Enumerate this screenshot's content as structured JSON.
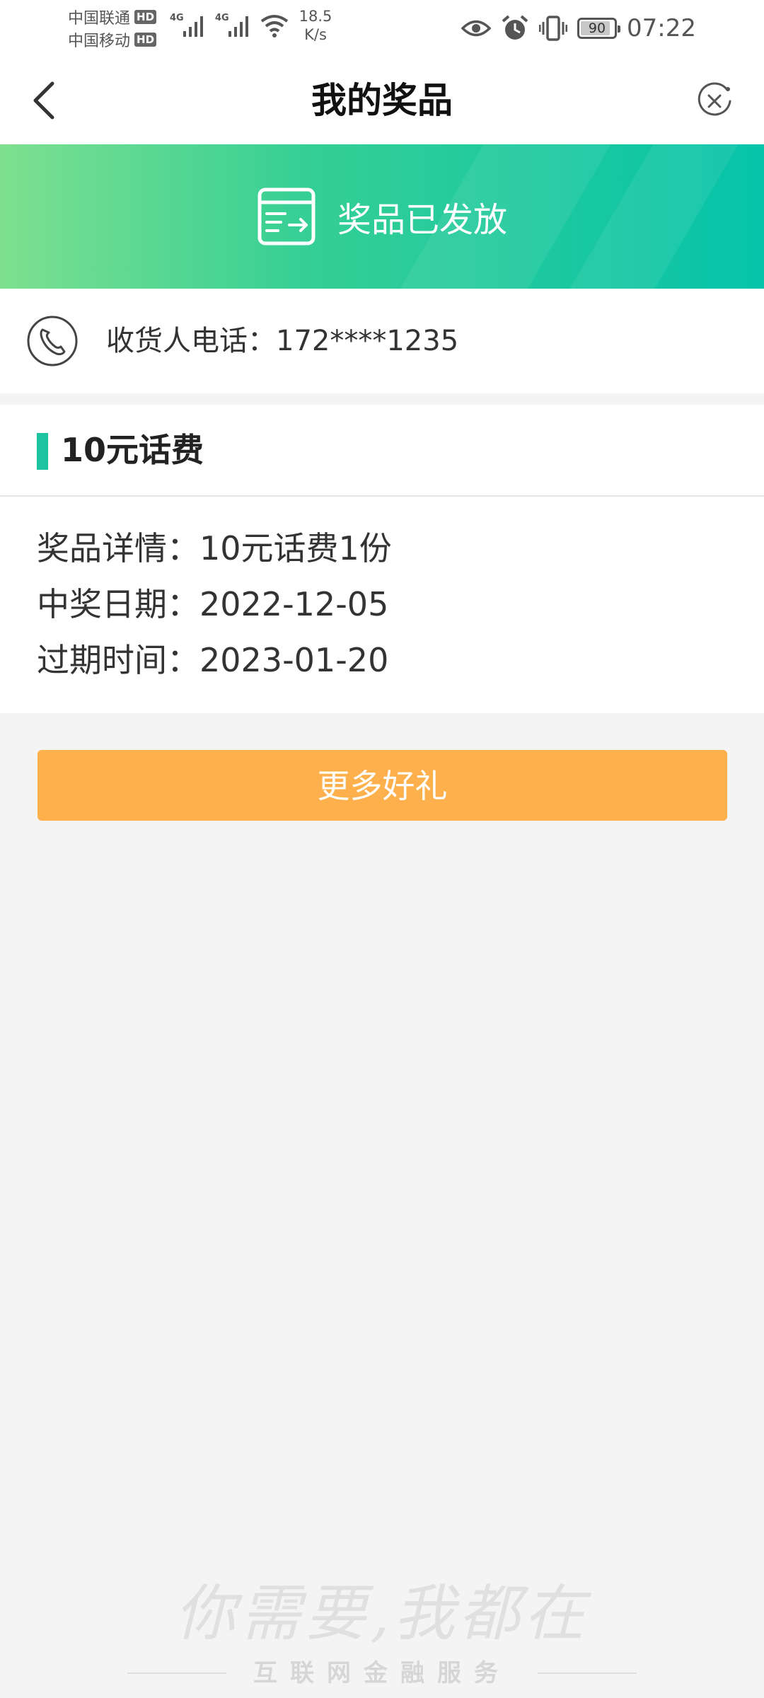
{
  "status_bar": {
    "carrier_1": "中国联通",
    "carrier_2": "中国移动",
    "hd_badge": "HD",
    "network_type": "4G",
    "net_speed_value": "18.5",
    "net_speed_unit": "K/s",
    "battery_level": "90",
    "time": "07:22",
    "icons": [
      "eye-icon",
      "alarm-icon",
      "vibrate-icon",
      "battery-icon",
      "wifi-icon",
      "signal-icon"
    ]
  },
  "navbar": {
    "title": "我的奖品"
  },
  "banner": {
    "text": "奖品已发放"
  },
  "phone_row": {
    "label": "收货人电话：172****1235"
  },
  "prize": {
    "title": "10元话费",
    "details": [
      {
        "label": "奖品详情：",
        "value": "10元话费1份"
      },
      {
        "label": "中奖日期：",
        "value": "2022-12-05"
      },
      {
        "label": "过期时间：",
        "value": "2023-01-20"
      }
    ]
  },
  "actions": {
    "more_gifts_label": "更多好礼"
  },
  "footer": {
    "slogan": "你需要,我都在",
    "tagline": "互联网金融服务"
  },
  "colors": {
    "banner_start": "#7ee08f",
    "banner_end": "#06c3a9",
    "accent": "#1cc4a2",
    "button": "#fdb04b",
    "background": "#f4f4f4"
  }
}
